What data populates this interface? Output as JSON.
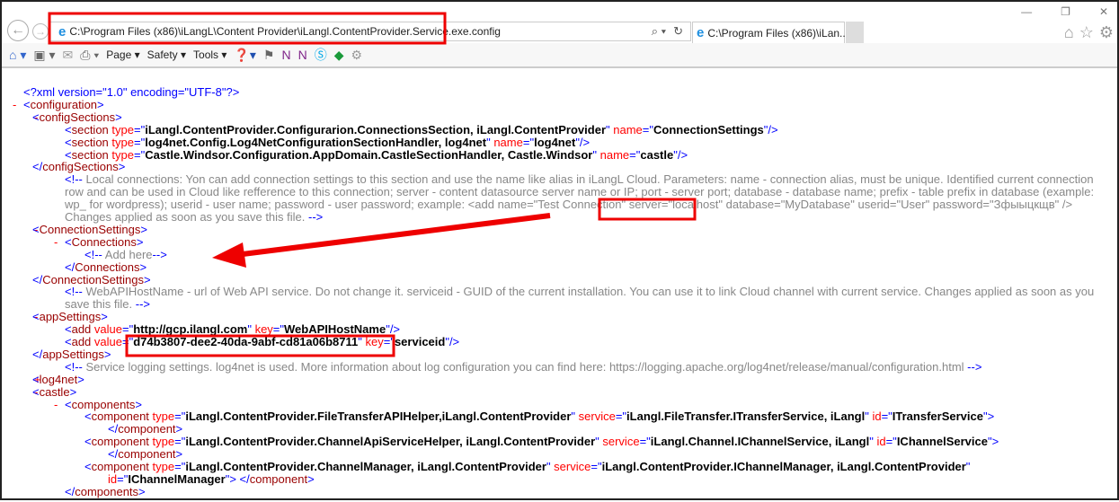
{
  "browser": {
    "address": "C:\\Program Files (x86)\\iLangL\\Content Provider\\iLangl.ContentProvider.Service.exe.config",
    "tab_title": "C:\\Program Files (x86)\\iLan...",
    "commands": {
      "page": "Page ▾",
      "safety": "Safety ▾",
      "tools": "Tools ▾"
    }
  },
  "lines": [
    {
      "d": 0,
      "s": [
        [
          "b",
          "<?xml version=\"1.0\" encoding=\"UTF-8\"?>"
        ]
      ]
    },
    {
      "d": 0,
      "mk": "-",
      "s": [
        [
          "b",
          "<"
        ],
        [
          "tg",
          "configuration"
        ],
        [
          "b",
          ">"
        ]
      ]
    },
    {
      "d": 1,
      "mk": "-",
      "s": [
        [
          "b",
          "<"
        ],
        [
          "tg",
          "configSections"
        ],
        [
          "b",
          ">"
        ]
      ]
    },
    {
      "d": 2,
      "s": [
        [
          "b",
          "<"
        ],
        [
          "tg",
          "section"
        ],
        [
          "an",
          " type"
        ],
        [
          "b",
          "=\""
        ],
        [
          "av",
          "iLangl.ContentProvider.Configurarion.ConnectionsSection, iLangl.ContentProvider"
        ],
        [
          "b",
          "\""
        ],
        [
          "an",
          " name"
        ],
        [
          "b",
          "=\""
        ],
        [
          "av",
          "ConnectionSettings"
        ],
        [
          "b",
          "\"/>"
        ]
      ]
    },
    {
      "d": 2,
      "s": [
        [
          "b",
          "<"
        ],
        [
          "tg",
          "section"
        ],
        [
          "an",
          " type"
        ],
        [
          "b",
          "=\""
        ],
        [
          "av",
          "log4net.Config.Log4NetConfigurationSectionHandler, log4net"
        ],
        [
          "b",
          "\""
        ],
        [
          "an",
          " name"
        ],
        [
          "b",
          "=\""
        ],
        [
          "av",
          "log4net"
        ],
        [
          "b",
          "\"/>"
        ]
      ]
    },
    {
      "d": 2,
      "s": [
        [
          "b",
          "<"
        ],
        [
          "tg",
          "section"
        ],
        [
          "an",
          " type"
        ],
        [
          "b",
          "=\""
        ],
        [
          "av",
          "Castle.Windsor.Configuration.AppDomain.CastleSectionHandler, Castle.Windsor"
        ],
        [
          "b",
          "\""
        ],
        [
          "an",
          " name"
        ],
        [
          "b",
          "=\""
        ],
        [
          "av",
          "castle"
        ],
        [
          "b",
          "\"/>"
        ]
      ]
    },
    {
      "d": 1,
      "s": [
        [
          "b",
          "</"
        ],
        [
          "tg",
          "configSections"
        ],
        [
          "b",
          ">"
        ]
      ]
    },
    {
      "d": 2,
      "n": 4,
      "s": [
        [
          "b",
          "<!--"
        ],
        [
          "cm",
          " Local connections: Yon can add connection settings to this section and use the name like alias in iLangL Cloud. Parameters: name - connection alias, must be unique. Identified current connection row and can be used in Cloud like refference to this connection; server - content datasource server name or IP; port - server port; database - database name; prefix - table prefix in database (example: wp_ for wordpress); userid - user name; password - user password; example: <add name=\"Test Connection\" server=\"localhost\" database=\"MyDatabase\" userid=\"User\" password=\"Зфыыцкщв\" /> Changes applied as soon as you save this file. "
        ],
        [
          "b",
          "-->"
        ]
      ]
    },
    {
      "d": 1,
      "mk": "-",
      "s": [
        [
          "b",
          "<"
        ],
        [
          "tg",
          "ConnectionSettings"
        ],
        [
          "b",
          ">"
        ]
      ]
    },
    {
      "d": 2,
      "mk": "-",
      "s": [
        [
          "b",
          "<"
        ],
        [
          "tg",
          "Connections"
        ],
        [
          "b",
          ">"
        ]
      ]
    },
    {
      "d": 3,
      "s": [
        [
          "b",
          "<!--"
        ],
        [
          "cm",
          " Add here"
        ],
        [
          "b",
          "-->"
        ]
      ]
    },
    {
      "d": 2,
      "s": [
        [
          "b",
          "</"
        ],
        [
          "tg",
          "Connections"
        ],
        [
          "b",
          ">"
        ]
      ]
    },
    {
      "d": 1,
      "s": [
        [
          "b",
          "</"
        ],
        [
          "tg",
          "ConnectionSettings"
        ],
        [
          "b",
          ">"
        ]
      ]
    },
    {
      "d": 2,
      "n": 2,
      "s": [
        [
          "b",
          "<!--"
        ],
        [
          "cm",
          " WebAPIHostName - url of Web API service. Do not change it. serviceid - GUID of the current installation. You can use it to link Cloud channel with current service. Changes applied as soon as you save this file. "
        ],
        [
          "b",
          "-->"
        ]
      ]
    },
    {
      "d": 1,
      "mk": "-",
      "s": [
        [
          "b",
          "<"
        ],
        [
          "tg",
          "appSettings"
        ],
        [
          "b",
          ">"
        ]
      ]
    },
    {
      "d": 2,
      "s": [
        [
          "b",
          "<"
        ],
        [
          "tg",
          "add"
        ],
        [
          "an",
          " value"
        ],
        [
          "b",
          "=\""
        ],
        [
          "av",
          "http://gcp.ilangl.com"
        ],
        [
          "b",
          "\""
        ],
        [
          "an",
          " key"
        ],
        [
          "b",
          "=\""
        ],
        [
          "av",
          "WebAPIHostName"
        ],
        [
          "b",
          "\"/>"
        ]
      ]
    },
    {
      "d": 2,
      "s": [
        [
          "b",
          "<"
        ],
        [
          "tg",
          "add"
        ],
        [
          "an",
          " value"
        ],
        [
          "b",
          "=\""
        ],
        [
          "av",
          "d74b3807-dee2-40da-9abf-cd81a06b8711"
        ],
        [
          "b",
          "\""
        ],
        [
          "an",
          " key"
        ],
        [
          "b",
          "=\""
        ],
        [
          "av",
          "serviceid"
        ],
        [
          "b",
          "\"/>"
        ]
      ]
    },
    {
      "d": 1,
      "s": [
        [
          "b",
          "</"
        ],
        [
          "tg",
          "appSettings"
        ],
        [
          "b",
          ">"
        ]
      ]
    },
    {
      "d": 2,
      "s": [
        [
          "b",
          "<!--"
        ],
        [
          "cm",
          " Service logging settings. log4net is used. More information about log configuration you can find here: https://logging.apache.org/log4net/release/manual/configuration.html "
        ],
        [
          "b",
          "-->"
        ]
      ]
    },
    {
      "d": 1,
      "mk": "+",
      "s": [
        [
          "b",
          "<"
        ],
        [
          "tg",
          "log4net"
        ],
        [
          "b",
          ">"
        ]
      ]
    },
    {
      "d": 1,
      "mk": "-",
      "s": [
        [
          "b",
          "<"
        ],
        [
          "tg",
          "castle"
        ],
        [
          "b",
          ">"
        ]
      ]
    },
    {
      "d": 2,
      "mk": "-",
      "s": [
        [
          "b",
          "<"
        ],
        [
          "tg",
          "components"
        ],
        [
          "b",
          ">"
        ]
      ]
    },
    {
      "d": 3,
      "s": [
        [
          "b",
          "<"
        ],
        [
          "tg",
          "component"
        ],
        [
          "an",
          " type"
        ],
        [
          "b",
          "=\""
        ],
        [
          "av",
          "iLangl.ContentProvider.FileTransferAPIHelper,iLangl.ContentProvider"
        ],
        [
          "b",
          "\""
        ],
        [
          "an",
          " service"
        ],
        [
          "b",
          "=\""
        ],
        [
          "av",
          "iLangl.FileTransfer.ITransferService, iLangl"
        ],
        [
          "b",
          "\""
        ],
        [
          "an",
          " id"
        ],
        [
          "b",
          "=\""
        ],
        [
          "av",
          "ITransferService"
        ],
        [
          "b",
          "\">"
        ]
      ]
    },
    {
      "d": 4,
      "s": [
        [
          "b",
          "</"
        ],
        [
          "tg",
          "component"
        ],
        [
          "b",
          ">"
        ]
      ]
    },
    {
      "d": 3,
      "s": [
        [
          "b",
          "<"
        ],
        [
          "tg",
          "component"
        ],
        [
          "an",
          " type"
        ],
        [
          "b",
          "=\""
        ],
        [
          "av",
          "iLangl.ContentProvider.ChannelApiServiceHelper, iLangl.ContentProvider"
        ],
        [
          "b",
          "\""
        ],
        [
          "an",
          " service"
        ],
        [
          "b",
          "=\""
        ],
        [
          "av",
          "iLangl.Channel.IChannelService, iLangl"
        ],
        [
          "b",
          "\""
        ],
        [
          "an",
          " id"
        ],
        [
          "b",
          "=\""
        ],
        [
          "av",
          "IChannelService"
        ],
        [
          "b",
          "\">"
        ]
      ]
    },
    {
      "d": 4,
      "s": [
        [
          "b",
          "</"
        ],
        [
          "tg",
          "component"
        ],
        [
          "b",
          ">"
        ]
      ]
    },
    {
      "d": 3,
      "s": [
        [
          "b",
          "<"
        ],
        [
          "tg",
          "component"
        ],
        [
          "an",
          " type"
        ],
        [
          "b",
          "=\""
        ],
        [
          "av",
          "iLangl.ContentProvider.ChannelManager, iLangl.ContentProvider"
        ],
        [
          "b",
          "\""
        ],
        [
          "an",
          " service"
        ],
        [
          "b",
          "=\""
        ],
        [
          "av",
          "iLangl.ContentProvider.IChannelManager, iLangl.ContentProvider"
        ],
        [
          "b",
          "\""
        ]
      ]
    },
    {
      "d": 4,
      "s": [
        [
          "an",
          "id"
        ],
        [
          "b",
          "=\""
        ],
        [
          "av",
          "IChannelManager"
        ],
        [
          "b",
          "\"> </"
        ],
        [
          "tg",
          "component"
        ],
        [
          "b",
          ">"
        ]
      ]
    },
    {
      "d": 2,
      "s": [
        [
          "b",
          "</"
        ],
        [
          "tg",
          "components"
        ],
        [
          "b",
          ">"
        ]
      ]
    }
  ]
}
